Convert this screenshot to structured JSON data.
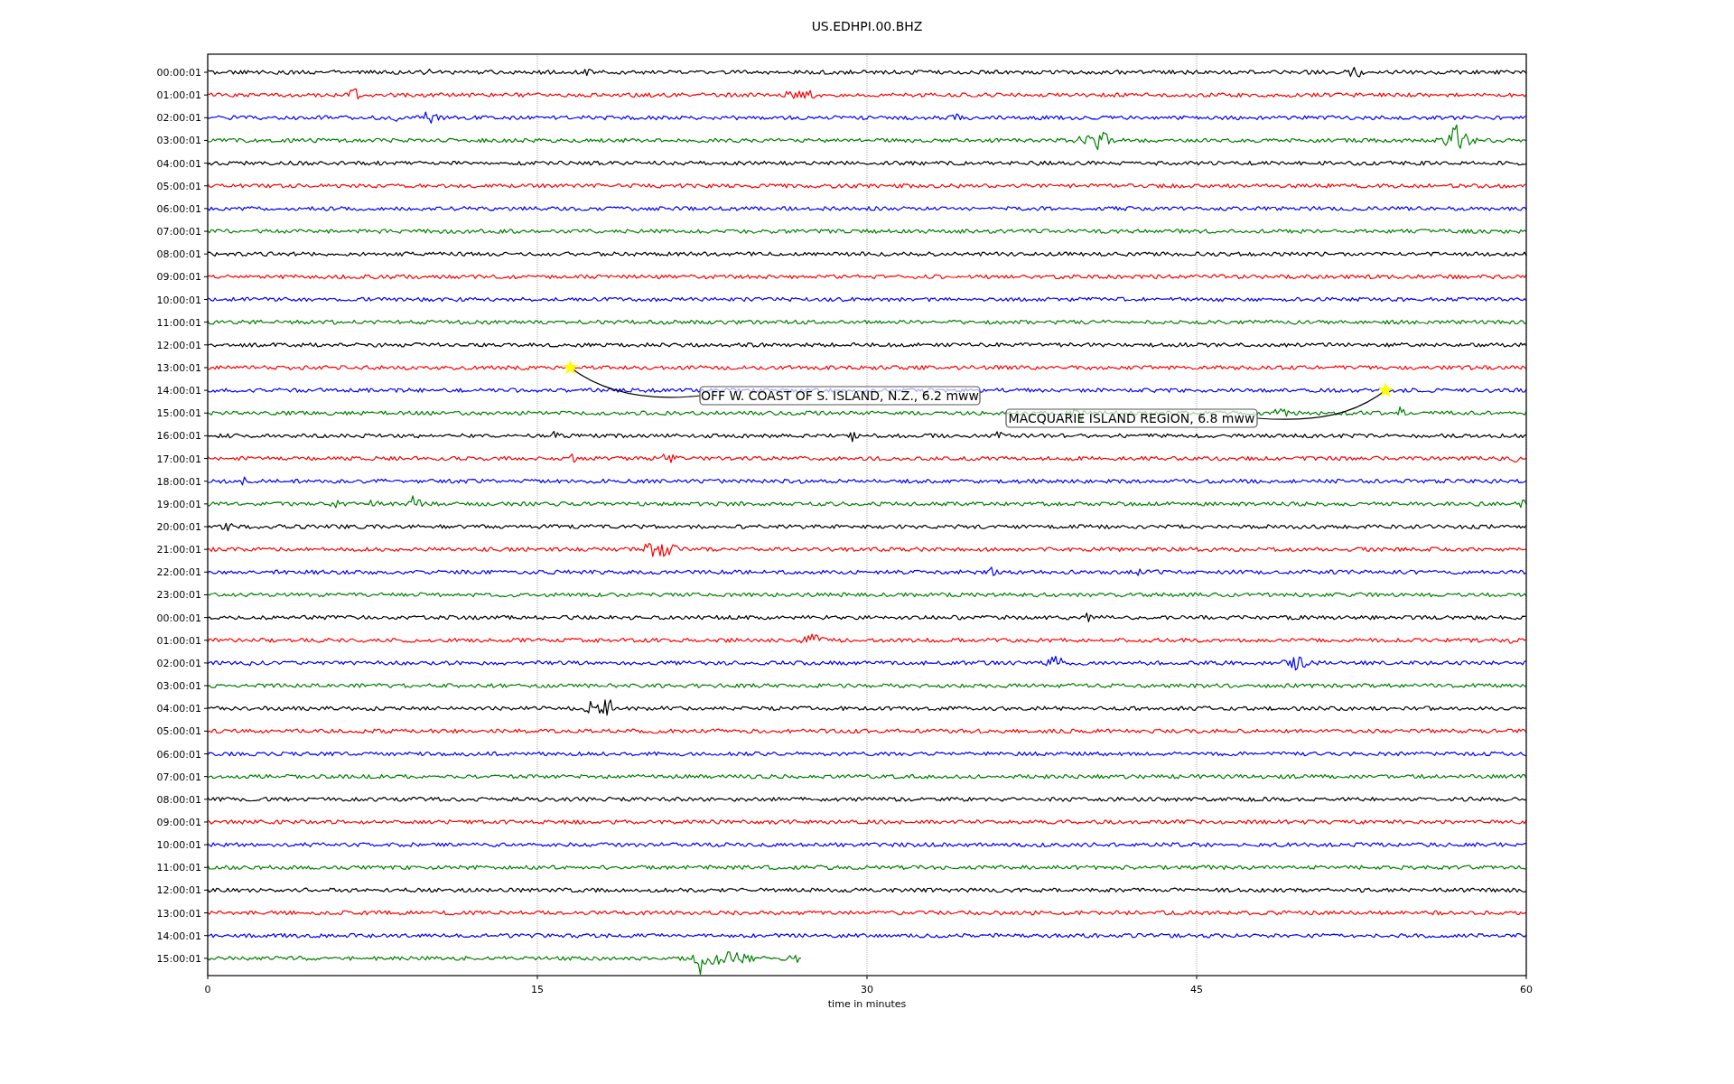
{
  "title": "US.EDHPI.00.BHZ",
  "rows": [
    {
      "label": "00:00:01",
      "color": "#000000"
    },
    {
      "label": "01:00:01",
      "color": "#ff0000"
    },
    {
      "label": "02:00:01",
      "color": "#0000ff"
    },
    {
      "label": "03:00:01",
      "color": "#008000"
    },
    {
      "label": "04:00:01",
      "color": "#000000"
    },
    {
      "label": "05:00:01",
      "color": "#ff0000"
    },
    {
      "label": "06:00:01",
      "color": "#0000ff"
    },
    {
      "label": "07:00:01",
      "color": "#008000"
    },
    {
      "label": "08:00:01",
      "color": "#000000"
    },
    {
      "label": "09:00:01",
      "color": "#ff0000"
    },
    {
      "label": "10:00:01",
      "color": "#0000ff"
    },
    {
      "label": "11:00:01",
      "color": "#008000"
    },
    {
      "label": "12:00:01",
      "color": "#000000"
    },
    {
      "label": "13:00:01",
      "color": "#ff0000"
    },
    {
      "label": "14:00:01",
      "color": "#0000ff"
    },
    {
      "label": "15:00:01",
      "color": "#008000"
    },
    {
      "label": "16:00:01",
      "color": "#000000"
    },
    {
      "label": "17:00:01",
      "color": "#ff0000"
    },
    {
      "label": "18:00:01",
      "color": "#0000ff"
    },
    {
      "label": "19:00:01",
      "color": "#008000"
    },
    {
      "label": "20:00:01",
      "color": "#000000"
    },
    {
      "label": "21:00:01",
      "color": "#ff0000"
    },
    {
      "label": "22:00:01",
      "color": "#0000ff"
    },
    {
      "label": "23:00:01",
      "color": "#008000"
    },
    {
      "label": "00:00:01",
      "color": "#000000"
    },
    {
      "label": "01:00:01",
      "color": "#ff0000"
    },
    {
      "label": "02:00:01",
      "color": "#0000ff"
    },
    {
      "label": "03:00:01",
      "color": "#008000"
    },
    {
      "label": "04:00:01",
      "color": "#000000"
    },
    {
      "label": "05:00:01",
      "color": "#ff0000"
    },
    {
      "label": "06:00:01",
      "color": "#0000ff"
    },
    {
      "label": "07:00:01",
      "color": "#008000"
    },
    {
      "label": "08:00:01",
      "color": "#000000"
    },
    {
      "label": "09:00:01",
      "color": "#ff0000"
    },
    {
      "label": "10:00:01",
      "color": "#0000ff"
    },
    {
      "label": "11:00:01",
      "color": "#008000"
    },
    {
      "label": "12:00:01",
      "color": "#000000"
    },
    {
      "label": "13:00:01",
      "color": "#ff0000"
    },
    {
      "label": "14:00:01",
      "color": "#0000ff"
    },
    {
      "label": "15:00:01",
      "color": "#008000"
    }
  ],
  "xticks": [
    "0",
    "15",
    "30",
    "45",
    "60"
  ],
  "xlabel": "time in minutes",
  "events": [
    {
      "text": "OFF W. COAST OF S. ISLAND, N.Z., 6.2 mww"
    },
    {
      "text": "MACQUARIE ISLAND REGION, 6.8 mww"
    }
  ]
}
